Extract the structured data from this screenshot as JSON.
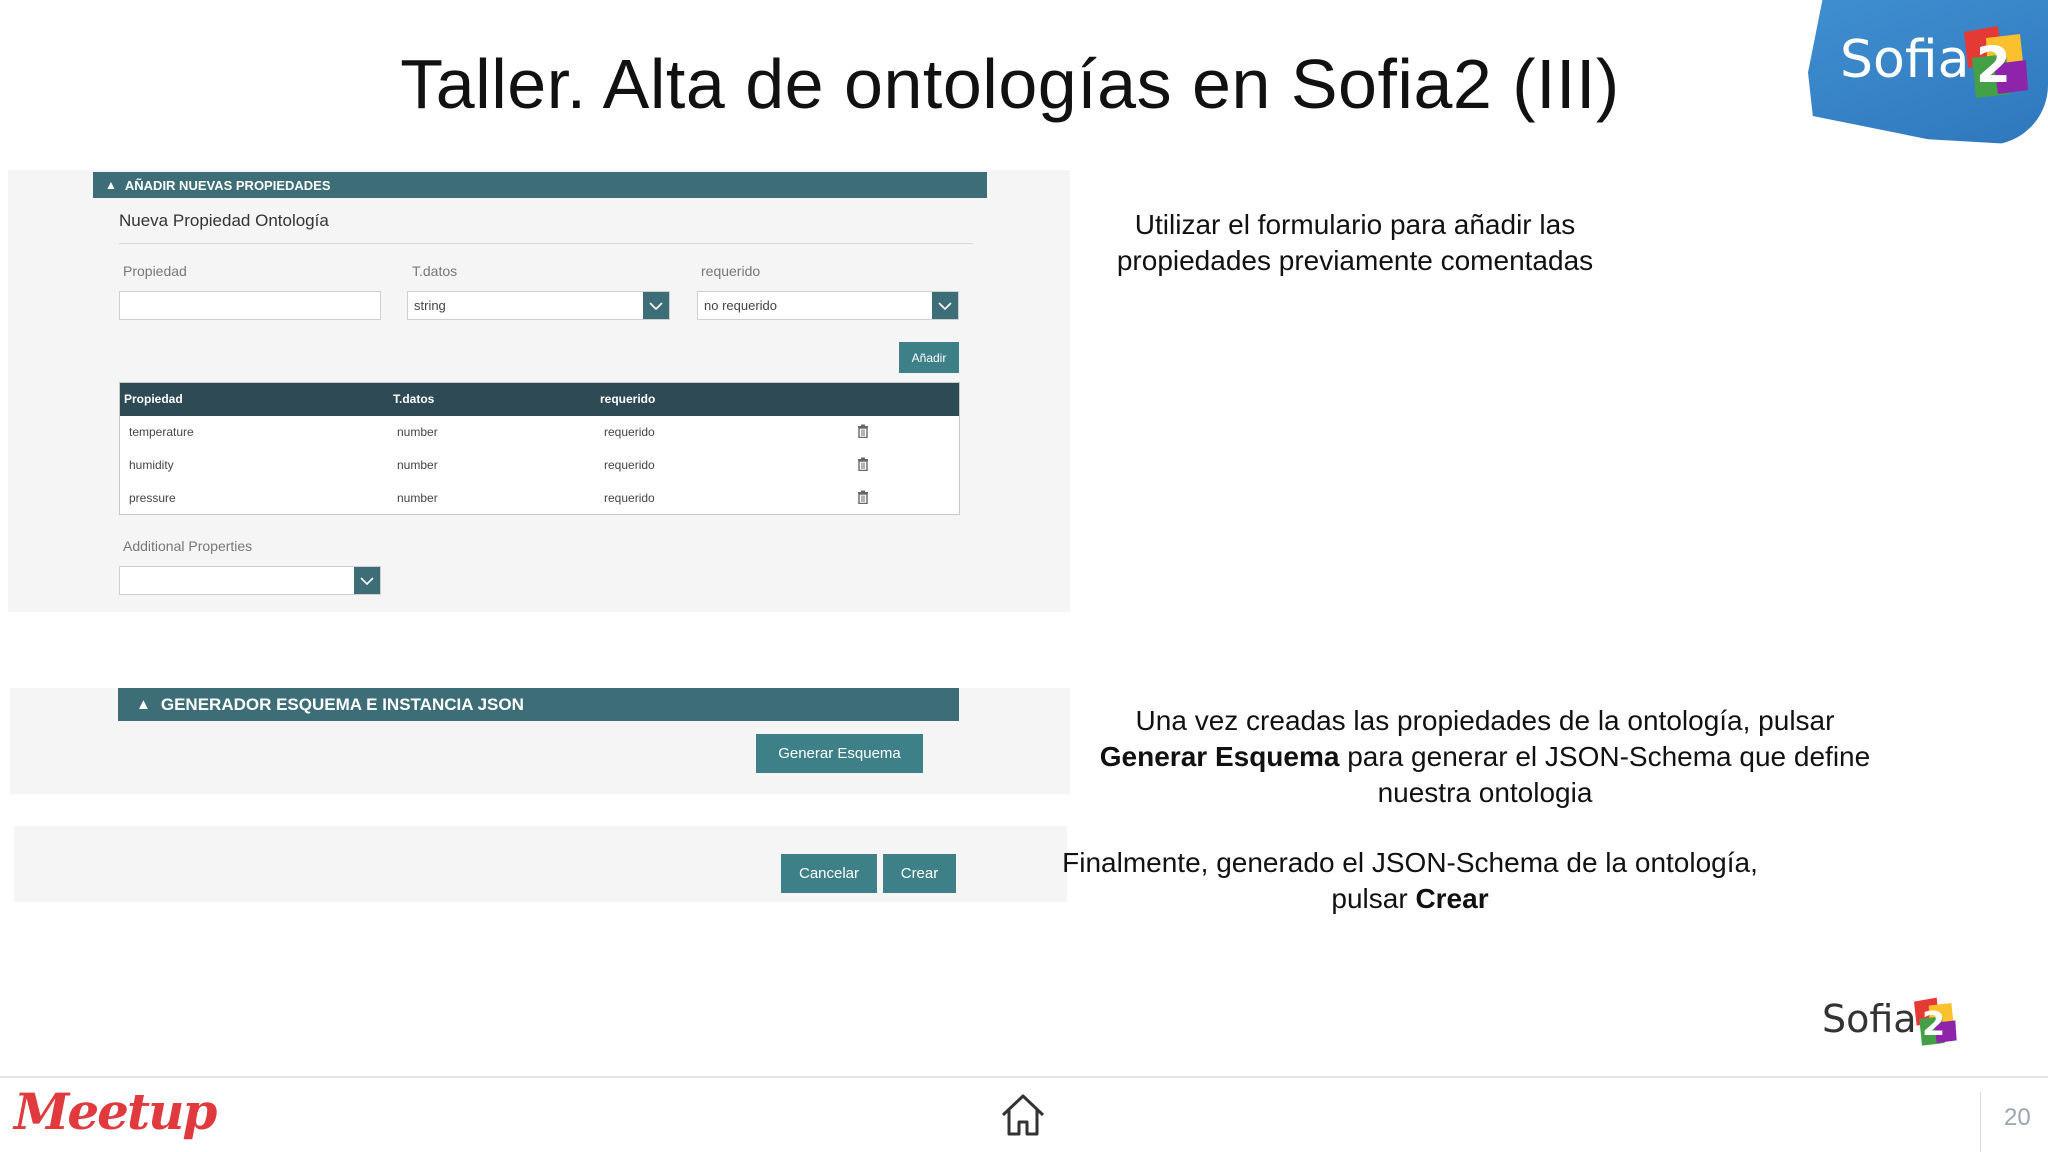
{
  "slide": {
    "title": "Taller. Alta de ontologías en Sofia2 (III)",
    "page_number": "20"
  },
  "logo": {
    "word": "Sofia"
  },
  "form": {
    "section_header": "AÑADIR NUEVAS PROPIEDADES",
    "subtitle": "Nueva Propiedad Ontología",
    "labels": {
      "propiedad": "Propiedad",
      "tdatos": "T.datos",
      "requerido": "requerido"
    },
    "propiedad_value": "",
    "tdatos_value": "string",
    "requerido_value": "no requerido",
    "add_button": "Añadir",
    "table": {
      "headers": [
        "Propiedad",
        "T.datos",
        "requerido"
      ],
      "rows": [
        {
          "propiedad": "temperature",
          "tdatos": "number",
          "requerido": "requerido"
        },
        {
          "propiedad": "humidity",
          "tdatos": "number",
          "requerido": "requerido"
        },
        {
          "propiedad": "pressure",
          "tdatos": "number",
          "requerido": "requerido"
        }
      ]
    },
    "additional_label": "Additional Properties",
    "additional_value": ""
  },
  "generator": {
    "section_header": "GENERADOR ESQUEMA E INSTANCIA JSON",
    "generate_button": "Generar Esquema"
  },
  "actions": {
    "cancel_button": "Cancelar",
    "create_button": "Crear"
  },
  "notes": {
    "n1": "Utilizar el formulario para añadir las propiedades previamente comentadas",
    "n2_pre": "Una vez creadas las propiedades de la ontología, pulsar",
    "n2_bold": "Generar Esquema",
    "n2_post": "para generar el JSON-Schema que define nuestra ontologia",
    "n3_pre": "Finalmente, generado el JSON-Schema de la ontología, pulsar",
    "n3_bold": "Crear"
  },
  "footer": {
    "brand": "Meetup"
  },
  "colors": {
    "teal": "#3d6e78",
    "table_header": "#2e4a55",
    "logo_blue": "#3f8fd0",
    "meetup_red": "#e0393e"
  }
}
